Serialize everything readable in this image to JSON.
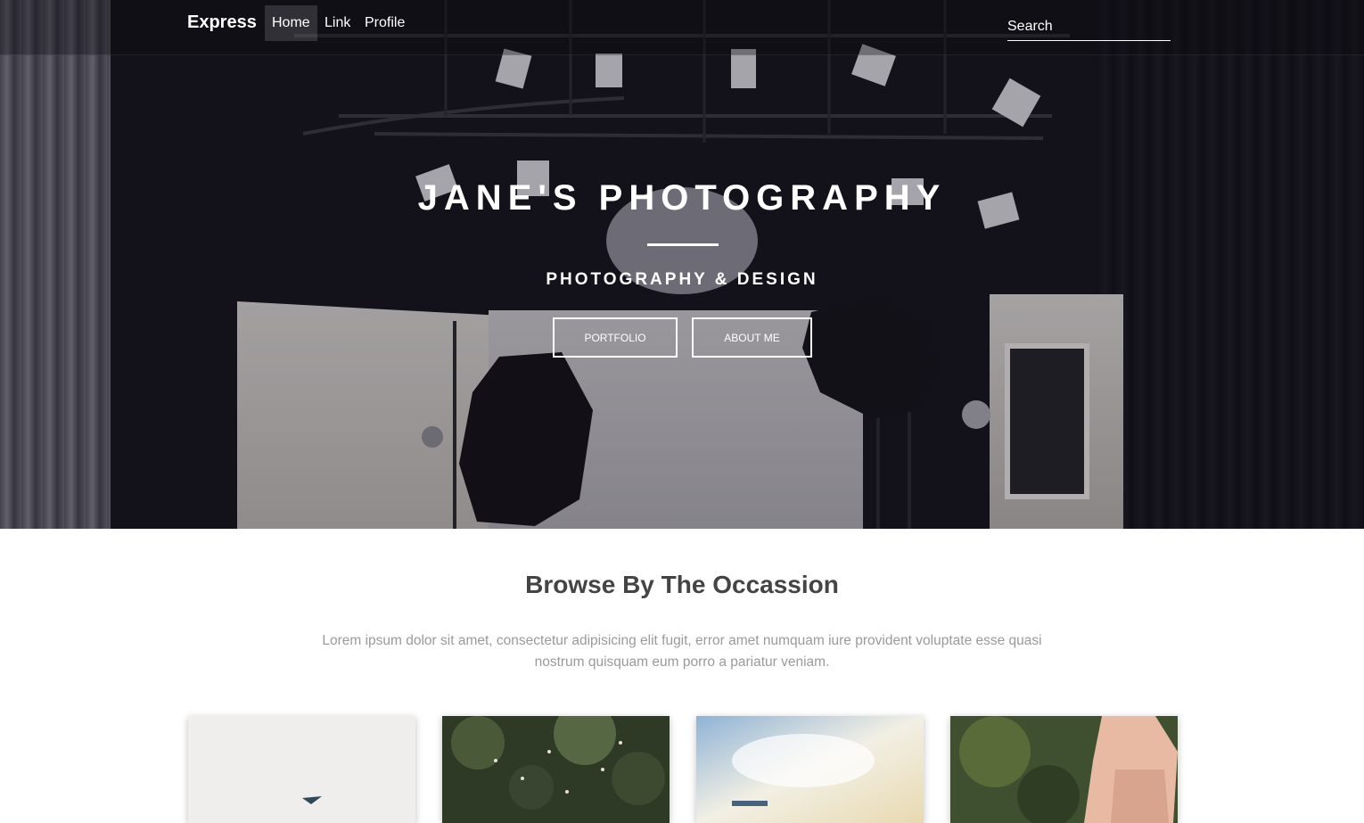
{
  "navbar": {
    "brand": "Express",
    "links": [
      {
        "label": "Home",
        "active": true
      },
      {
        "label": "Link",
        "active": false
      },
      {
        "label": "Profile",
        "active": false
      }
    ],
    "search_placeholder": "Search"
  },
  "hero": {
    "title": "JANE'S PHOTOGRAPHY",
    "subtitle": "PHOTOGRAPHY & DESIGN",
    "buttons": [
      {
        "label": "PORTFOLIO"
      },
      {
        "label": "ABOUT ME"
      }
    ]
  },
  "section": {
    "title": "Browse By The Occassion",
    "text": "Lorem ipsum dolor sit amet, consectetur adipisicing elit fugit, error amet numquam iure provident voluptate esse quasi nostrum quisquam eum porro a pariatur veniam."
  },
  "cards": [
    {
      "name": "occasion-card-1"
    },
    {
      "name": "occasion-card-2"
    },
    {
      "name": "occasion-card-3"
    },
    {
      "name": "occasion-card-4"
    }
  ],
  "colors": {
    "hero_dark": "#16141d",
    "heading": "#444444",
    "body_text": "#9a9a9a",
    "white": "#ffffff"
  }
}
